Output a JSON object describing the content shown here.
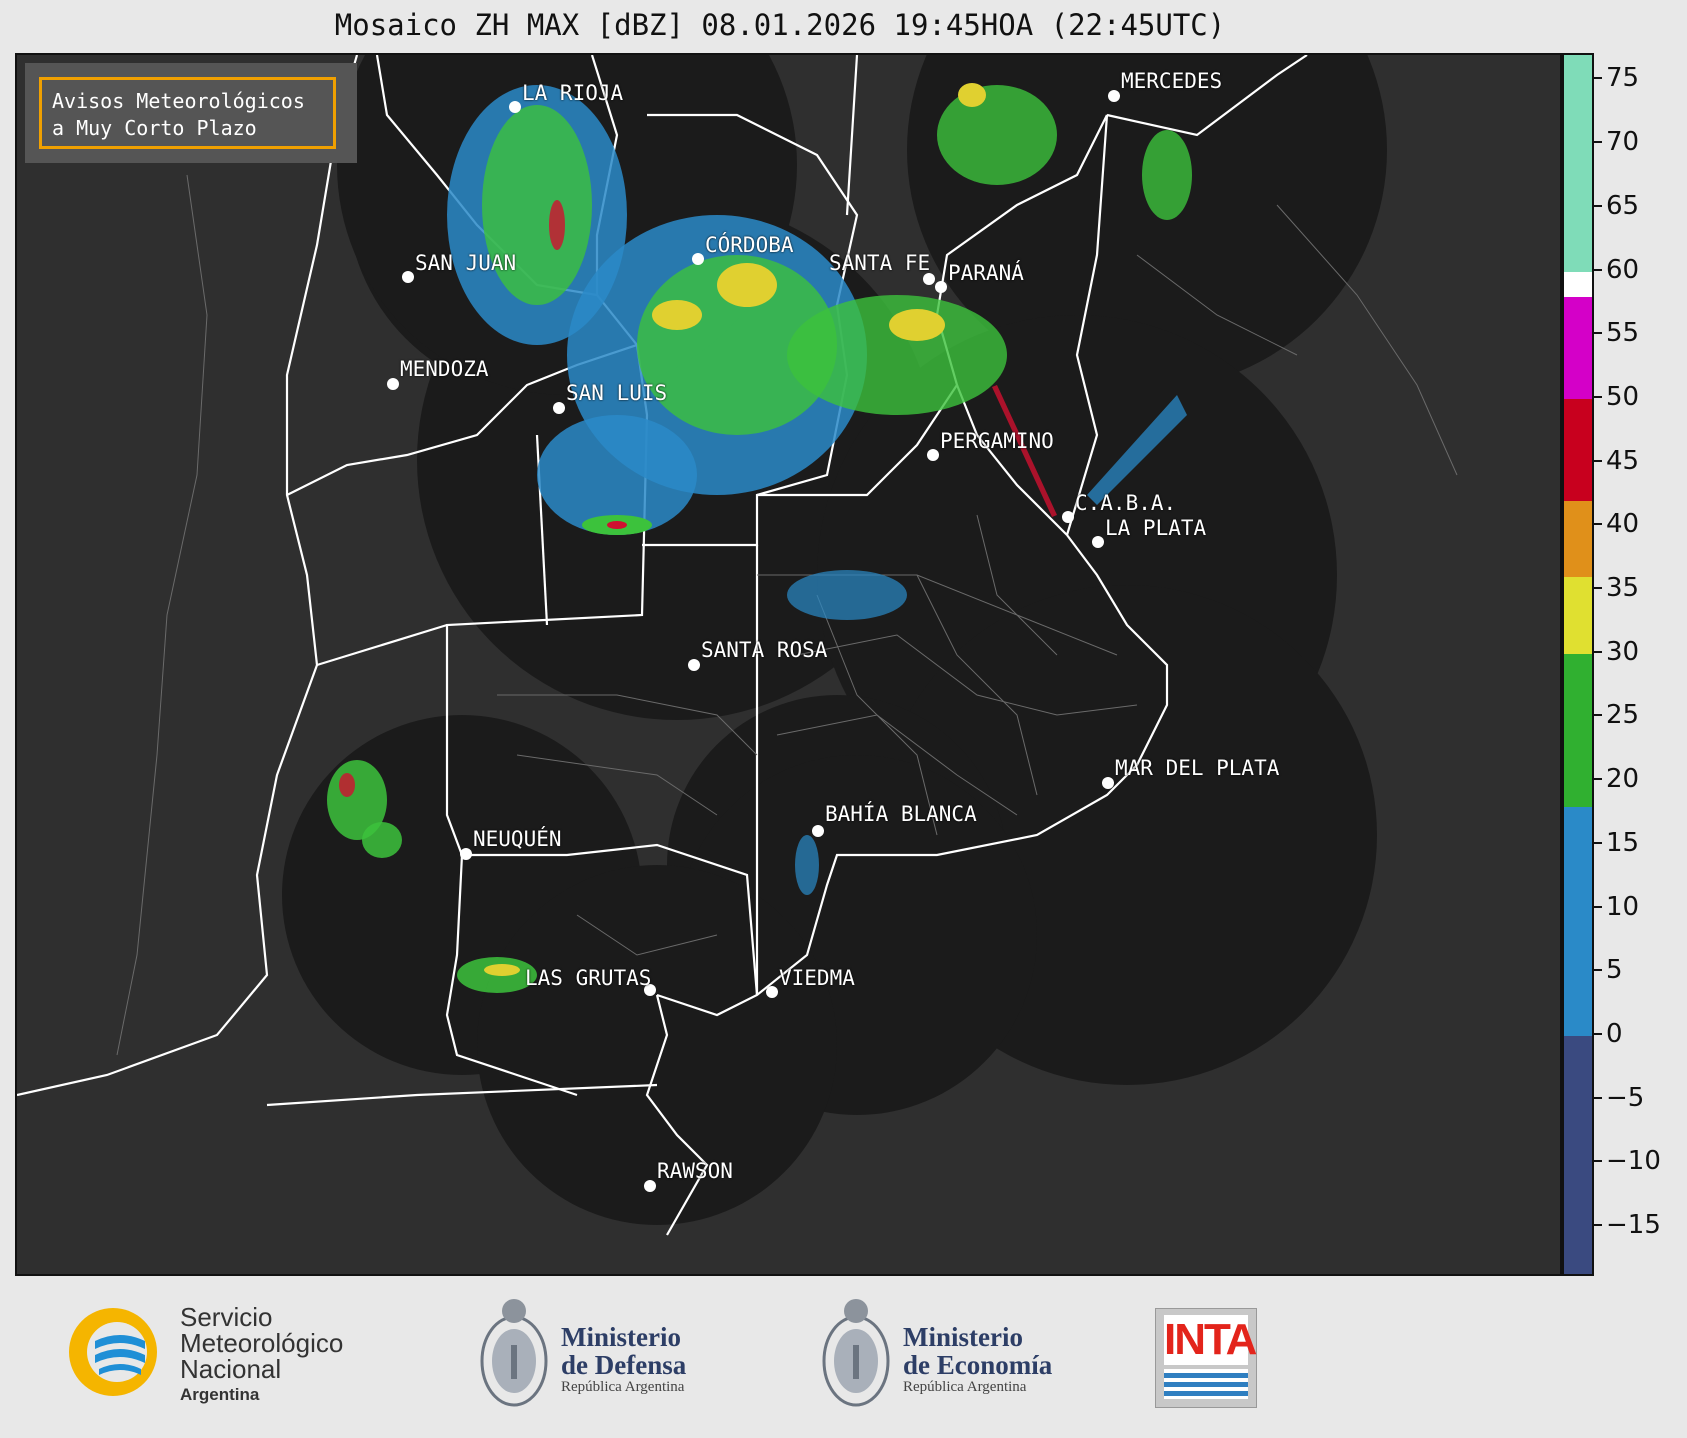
{
  "title": "Mosaico ZH MAX [dBZ] 08.01.2026 19:45HOA (22:45UTC)",
  "notice": {
    "line1": "Avisos Meteorológicos",
    "line2": "a Muy Corto Plazo"
  },
  "cities": [
    {
      "id": "la-rioja",
      "name": "LA RIOJA"
    },
    {
      "id": "san-juan",
      "name": "SAN JUAN"
    },
    {
      "id": "cordoba",
      "name": "CÓRDOBA"
    },
    {
      "id": "santa-fe",
      "name": "SANTA FE"
    },
    {
      "id": "parana",
      "name": "PARANÁ"
    },
    {
      "id": "mendoza",
      "name": "MENDOZA"
    },
    {
      "id": "san-luis",
      "name": "SAN LUIS"
    },
    {
      "id": "pergamino",
      "name": "PERGAMINO"
    },
    {
      "id": "mercedes",
      "name": "MERCEDES"
    },
    {
      "id": "caba",
      "name": "C.A.B.A."
    },
    {
      "id": "la-plata",
      "name": "LA PLATA"
    },
    {
      "id": "santa-rosa",
      "name": "SANTA ROSA"
    },
    {
      "id": "mar-del-plata",
      "name": "MAR DEL PLATA"
    },
    {
      "id": "bahia-blanca",
      "name": "BAHÍA BLANCA"
    },
    {
      "id": "neuquen",
      "name": "NEUQUÉN"
    },
    {
      "id": "las-grutas",
      "name": "LAS GRUTAS"
    },
    {
      "id": "viedma",
      "name": "VIEDMA"
    },
    {
      "id": "rawson",
      "name": "RAWSON"
    }
  ],
  "colorbar": {
    "ticks": [
      "75",
      "70",
      "65",
      "60",
      "55",
      "50",
      "45",
      "40",
      "35",
      "30",
      "25",
      "20",
      "15",
      "10",
      "5",
      "0",
      "−5",
      "−10",
      "−15"
    ],
    "tick_values": [
      75,
      70,
      65,
      60,
      55,
      50,
      45,
      40,
      35,
      30,
      25,
      20,
      15,
      10,
      5,
      0,
      -5,
      -10,
      -15
    ],
    "range": [
      -19,
      77
    ],
    "bands": [
      {
        "from": 60,
        "to": 77,
        "color": "#7fdcb8"
      },
      {
        "from": 58,
        "to": 60,
        "color": "#ffffff"
      },
      {
        "from": 50,
        "to": 58,
        "color": "#d400c8"
      },
      {
        "from": 42,
        "to": 50,
        "color": "#c8001e"
      },
      {
        "from": 36,
        "to": 42,
        "color": "#e0901a"
      },
      {
        "from": 30,
        "to": 36,
        "color": "#e0e030"
      },
      {
        "from": 18,
        "to": 30,
        "color": "#30b030"
      },
      {
        "from": 0,
        "to": 18,
        "color": "#2a8ac8"
      },
      {
        "from": -19,
        "to": 0,
        "color": "#3a4a80"
      }
    ]
  },
  "colors": {
    "radar_coverage": "#1b1b1b",
    "background_land": "#2f2f2f",
    "province_border": "#ffffff",
    "notice_border": "#f0a000",
    "echo_blue": "#2a8ac8",
    "echo_green": "#3cc23c",
    "echo_yellow": "#e0d030",
    "echo_red": "#d01030"
  },
  "footer": {
    "smn": {
      "line1": "Servicio",
      "line2": "Meteorológico",
      "line3": "Nacional",
      "line4": "Argentina"
    },
    "defensa": {
      "line1": "Ministerio",
      "line2": "de Defensa",
      "line3": "República Argentina"
    },
    "economia": {
      "line1": "Ministerio",
      "line2": "de Economía",
      "line3": "República Argentina"
    },
    "inta": "INTA"
  }
}
